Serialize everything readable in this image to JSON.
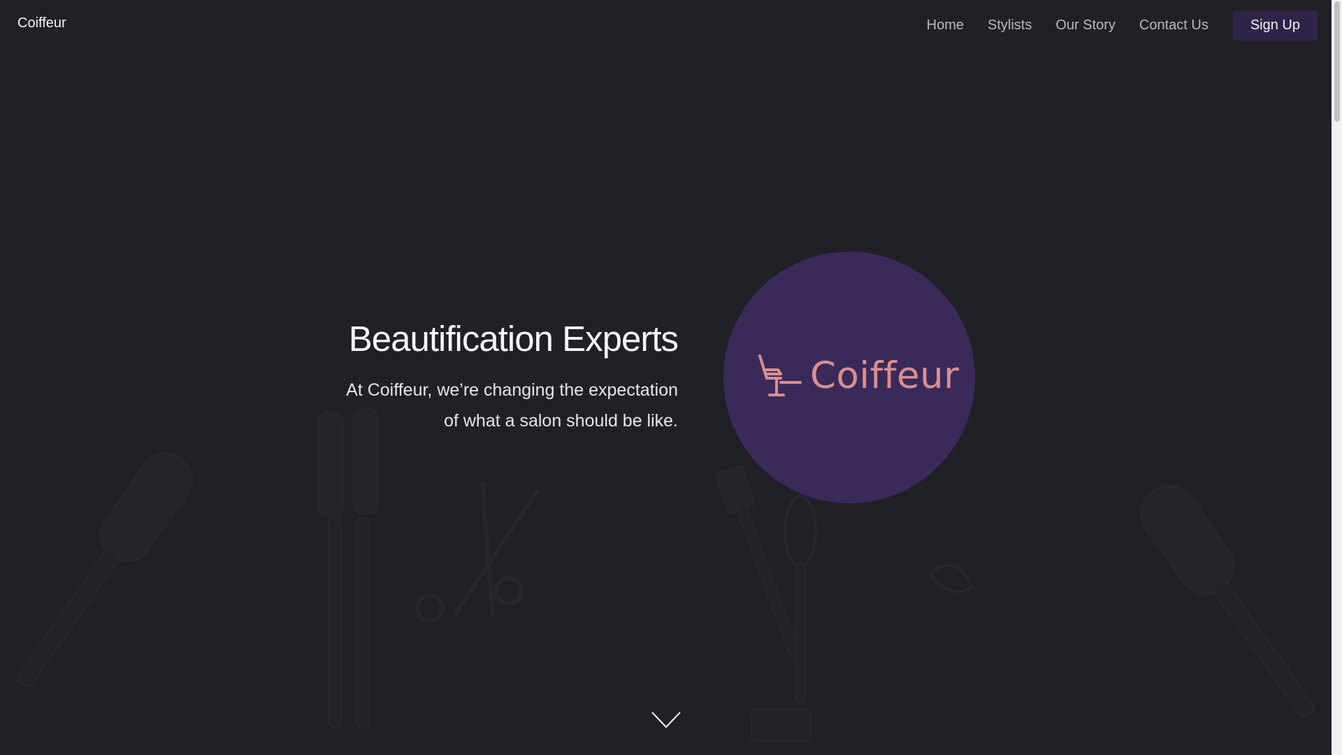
{
  "nav": {
    "brand": "Coiffeur",
    "links": [
      {
        "label": "Home"
      },
      {
        "label": "Stylists"
      },
      {
        "label": "Our Story"
      },
      {
        "label": "Contact Us"
      }
    ],
    "signup_label": "Sign Up"
  },
  "hero": {
    "title": "Beautification Experts",
    "subtitle_line1": "At Coiffeur, we’re changing the expectation",
    "subtitle_line2": "of what a salon should be like."
  },
  "logo": {
    "wordmark": "Coiffeur",
    "icon": "salon-chair-icon"
  },
  "colors": {
    "background": "#202127",
    "accent_purple": "#3a2a5a",
    "signup_bg": "#2e2447",
    "logo_pink": "#d98f8f"
  },
  "icons": {
    "scroll": "chevron-down-icon"
  }
}
